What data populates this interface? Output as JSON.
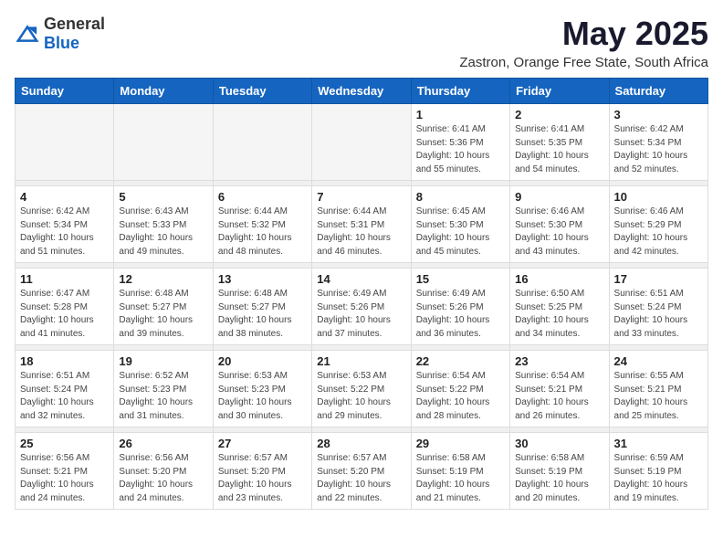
{
  "header": {
    "logo_general": "General",
    "logo_blue": "Blue",
    "month_title": "May 2025",
    "subtitle": "Zastron, Orange Free State, South Africa"
  },
  "weekdays": [
    "Sunday",
    "Monday",
    "Tuesday",
    "Wednesday",
    "Thursday",
    "Friday",
    "Saturday"
  ],
  "weeks": [
    [
      {
        "day": "",
        "info": ""
      },
      {
        "day": "",
        "info": ""
      },
      {
        "day": "",
        "info": ""
      },
      {
        "day": "",
        "info": ""
      },
      {
        "day": "1",
        "info": "Sunrise: 6:41 AM\nSunset: 5:36 PM\nDaylight: 10 hours\nand 55 minutes."
      },
      {
        "day": "2",
        "info": "Sunrise: 6:41 AM\nSunset: 5:35 PM\nDaylight: 10 hours\nand 54 minutes."
      },
      {
        "day": "3",
        "info": "Sunrise: 6:42 AM\nSunset: 5:34 PM\nDaylight: 10 hours\nand 52 minutes."
      }
    ],
    [
      {
        "day": "4",
        "info": "Sunrise: 6:42 AM\nSunset: 5:34 PM\nDaylight: 10 hours\nand 51 minutes."
      },
      {
        "day": "5",
        "info": "Sunrise: 6:43 AM\nSunset: 5:33 PM\nDaylight: 10 hours\nand 49 minutes."
      },
      {
        "day": "6",
        "info": "Sunrise: 6:44 AM\nSunset: 5:32 PM\nDaylight: 10 hours\nand 48 minutes."
      },
      {
        "day": "7",
        "info": "Sunrise: 6:44 AM\nSunset: 5:31 PM\nDaylight: 10 hours\nand 46 minutes."
      },
      {
        "day": "8",
        "info": "Sunrise: 6:45 AM\nSunset: 5:30 PM\nDaylight: 10 hours\nand 45 minutes."
      },
      {
        "day": "9",
        "info": "Sunrise: 6:46 AM\nSunset: 5:30 PM\nDaylight: 10 hours\nand 43 minutes."
      },
      {
        "day": "10",
        "info": "Sunrise: 6:46 AM\nSunset: 5:29 PM\nDaylight: 10 hours\nand 42 minutes."
      }
    ],
    [
      {
        "day": "11",
        "info": "Sunrise: 6:47 AM\nSunset: 5:28 PM\nDaylight: 10 hours\nand 41 minutes."
      },
      {
        "day": "12",
        "info": "Sunrise: 6:48 AM\nSunset: 5:27 PM\nDaylight: 10 hours\nand 39 minutes."
      },
      {
        "day": "13",
        "info": "Sunrise: 6:48 AM\nSunset: 5:27 PM\nDaylight: 10 hours\nand 38 minutes."
      },
      {
        "day": "14",
        "info": "Sunrise: 6:49 AM\nSunset: 5:26 PM\nDaylight: 10 hours\nand 37 minutes."
      },
      {
        "day": "15",
        "info": "Sunrise: 6:49 AM\nSunset: 5:26 PM\nDaylight: 10 hours\nand 36 minutes."
      },
      {
        "day": "16",
        "info": "Sunrise: 6:50 AM\nSunset: 5:25 PM\nDaylight: 10 hours\nand 34 minutes."
      },
      {
        "day": "17",
        "info": "Sunrise: 6:51 AM\nSunset: 5:24 PM\nDaylight: 10 hours\nand 33 minutes."
      }
    ],
    [
      {
        "day": "18",
        "info": "Sunrise: 6:51 AM\nSunset: 5:24 PM\nDaylight: 10 hours\nand 32 minutes."
      },
      {
        "day": "19",
        "info": "Sunrise: 6:52 AM\nSunset: 5:23 PM\nDaylight: 10 hours\nand 31 minutes."
      },
      {
        "day": "20",
        "info": "Sunrise: 6:53 AM\nSunset: 5:23 PM\nDaylight: 10 hours\nand 30 minutes."
      },
      {
        "day": "21",
        "info": "Sunrise: 6:53 AM\nSunset: 5:22 PM\nDaylight: 10 hours\nand 29 minutes."
      },
      {
        "day": "22",
        "info": "Sunrise: 6:54 AM\nSunset: 5:22 PM\nDaylight: 10 hours\nand 28 minutes."
      },
      {
        "day": "23",
        "info": "Sunrise: 6:54 AM\nSunset: 5:21 PM\nDaylight: 10 hours\nand 26 minutes."
      },
      {
        "day": "24",
        "info": "Sunrise: 6:55 AM\nSunset: 5:21 PM\nDaylight: 10 hours\nand 25 minutes."
      }
    ],
    [
      {
        "day": "25",
        "info": "Sunrise: 6:56 AM\nSunset: 5:21 PM\nDaylight: 10 hours\nand 24 minutes."
      },
      {
        "day": "26",
        "info": "Sunrise: 6:56 AM\nSunset: 5:20 PM\nDaylight: 10 hours\nand 24 minutes."
      },
      {
        "day": "27",
        "info": "Sunrise: 6:57 AM\nSunset: 5:20 PM\nDaylight: 10 hours\nand 23 minutes."
      },
      {
        "day": "28",
        "info": "Sunrise: 6:57 AM\nSunset: 5:20 PM\nDaylight: 10 hours\nand 22 minutes."
      },
      {
        "day": "29",
        "info": "Sunrise: 6:58 AM\nSunset: 5:19 PM\nDaylight: 10 hours\nand 21 minutes."
      },
      {
        "day": "30",
        "info": "Sunrise: 6:58 AM\nSunset: 5:19 PM\nDaylight: 10 hours\nand 20 minutes."
      },
      {
        "day": "31",
        "info": "Sunrise: 6:59 AM\nSunset: 5:19 PM\nDaylight: 10 hours\nand 19 minutes."
      }
    ]
  ]
}
